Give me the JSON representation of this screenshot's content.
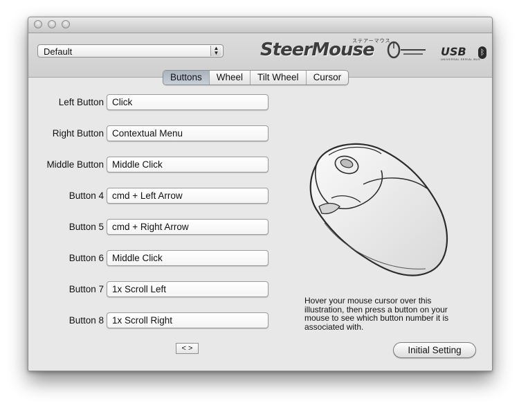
{
  "profile": {
    "selected": "Default"
  },
  "brand": {
    "name": "SteerMouse",
    "kana": "ステアーマウス",
    "usb": "USB",
    "usb_sub": "UNIVERSAL SERIAL BUS"
  },
  "tabs": [
    {
      "label": "Buttons",
      "active": true
    },
    {
      "label": "Wheel",
      "active": false
    },
    {
      "label": "Tilt Wheel",
      "active": false
    },
    {
      "label": "Cursor",
      "active": false
    }
  ],
  "buttons": [
    {
      "label": "Left Button",
      "action": "Click"
    },
    {
      "label": "Right Button",
      "action": "Contextual Menu"
    },
    {
      "label": "Middle Button",
      "action": "Middle Click"
    },
    {
      "label": "Button 4",
      "action": "cmd + Left Arrow"
    },
    {
      "label": "Button 5",
      "action": "cmd + Right Arrow"
    },
    {
      "label": "Button 6",
      "action": "Middle Click"
    },
    {
      "label": "Button 7",
      "action": "1x Scroll Left"
    },
    {
      "label": "Button 8",
      "action": "1x Scroll Right"
    }
  ],
  "scroll_button_label": "< >",
  "hint": "Hover your mouse cursor over this illustration, then press a button on your mouse to see which button number it is associated with.",
  "initial_setting_label": "Initial Setting",
  "icons": {
    "popup_arrows": "up-down-arrows-icon",
    "bluetooth": "bluetooth-icon"
  }
}
